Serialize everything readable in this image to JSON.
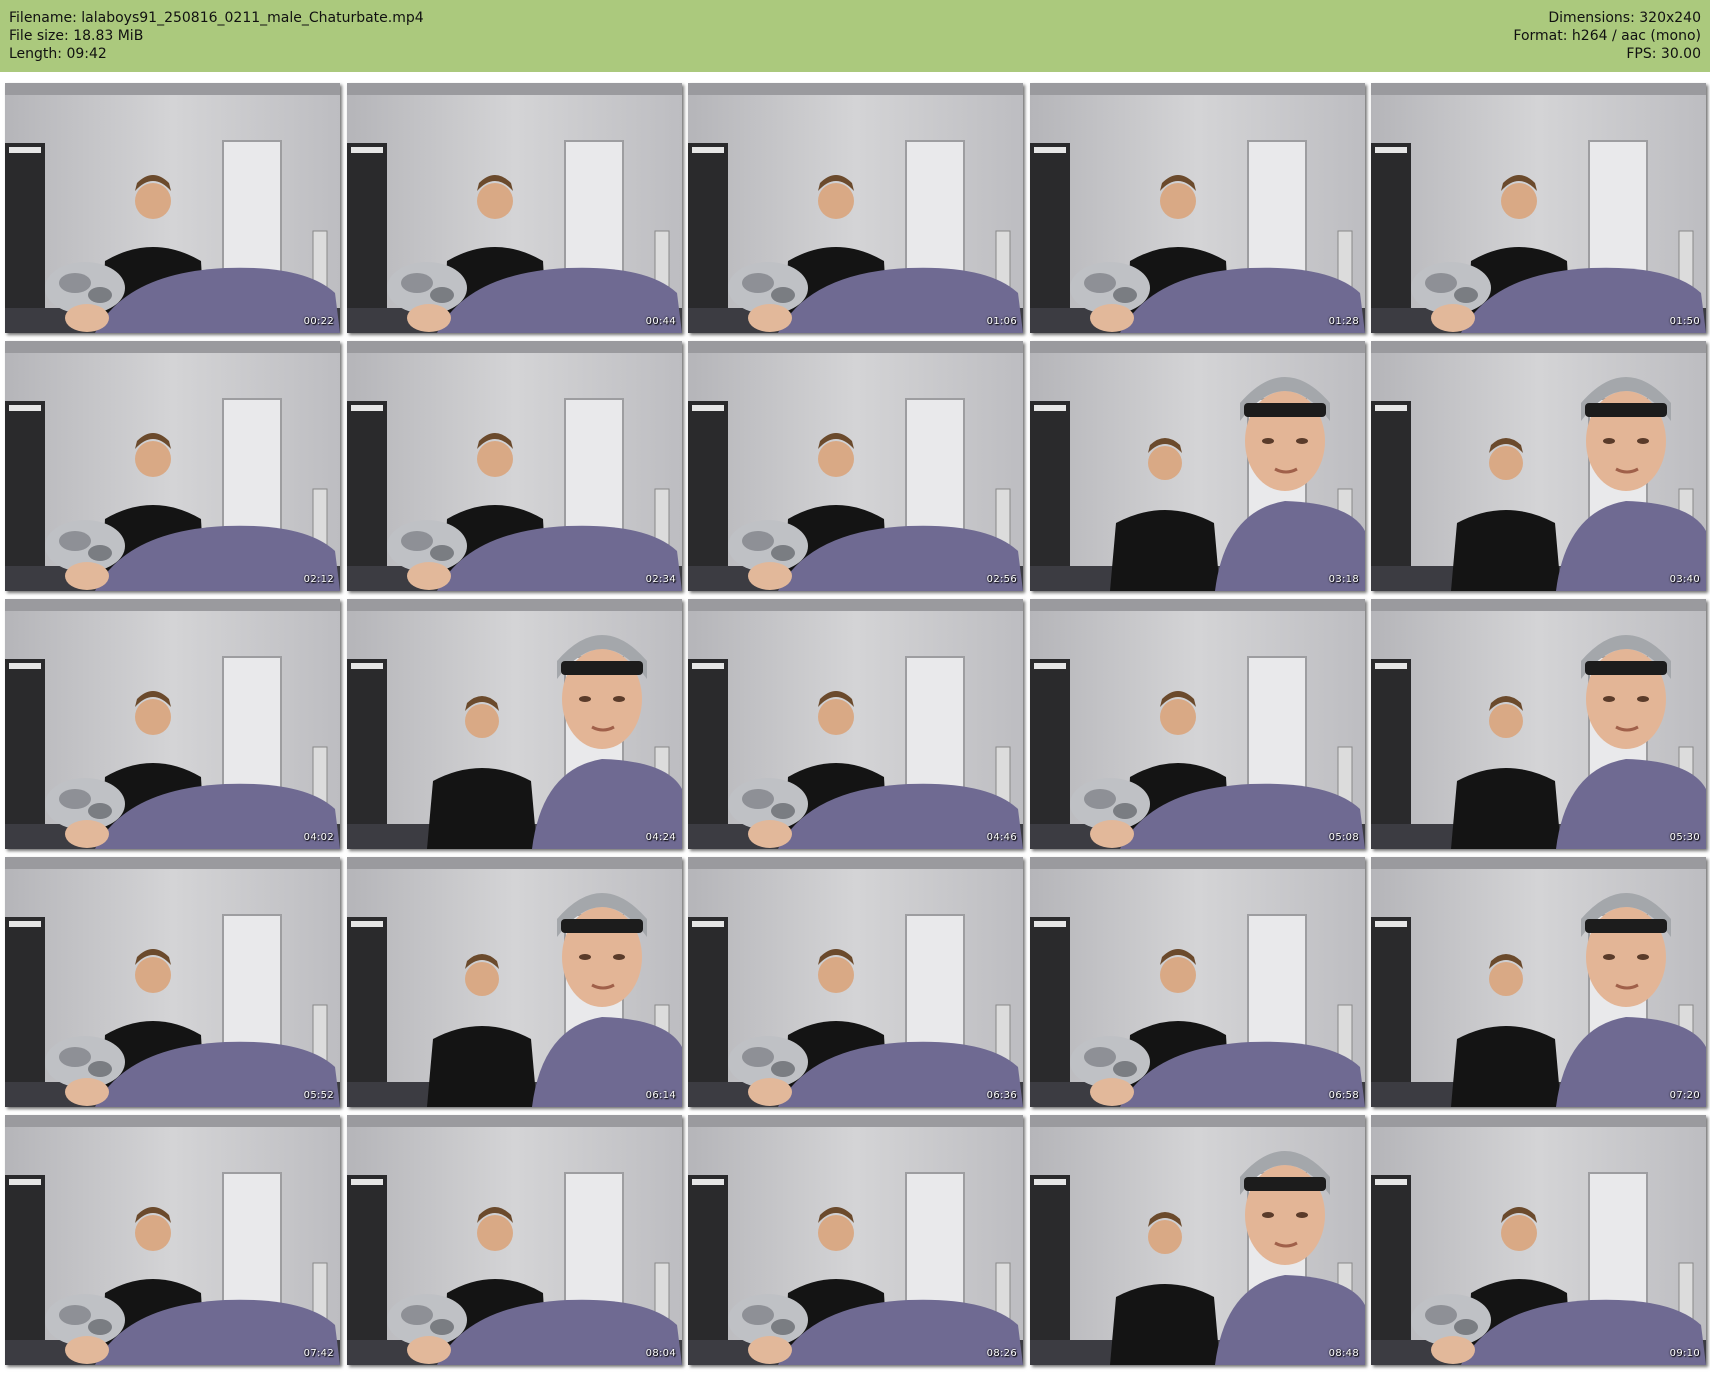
{
  "header": {
    "filename": "Filename: lalaboys91_250816_0211_male_Chaturbate.mp4",
    "filesize": "File size: 18.83 MiB",
    "length": "Length: 09:42",
    "dimensions": "Dimensions: 320x240",
    "format": "Format: h264 / aac (mono)",
    "fps": "FPS: 30.00"
  },
  "colors": {
    "header_bg": "#abc97d",
    "wall": "#c9c9cc",
    "shirt_purple": "#6f6a92",
    "shirt_black": "#141414"
  },
  "thumbnails": [
    {
      "time": "00:22",
      "scene": "lean"
    },
    {
      "time": "00:44",
      "scene": "lean"
    },
    {
      "time": "01:06",
      "scene": "lean"
    },
    {
      "time": "01:28",
      "scene": "lean"
    },
    {
      "time": "01:50",
      "scene": "lean"
    },
    {
      "time": "02:12",
      "scene": "lean"
    },
    {
      "time": "02:34",
      "scene": "lean"
    },
    {
      "time": "02:56",
      "scene": "lean"
    },
    {
      "time": "03:18",
      "scene": "face"
    },
    {
      "time": "03:40",
      "scene": "face"
    },
    {
      "time": "04:02",
      "scene": "lean"
    },
    {
      "time": "04:24",
      "scene": "face"
    },
    {
      "time": "04:46",
      "scene": "lean"
    },
    {
      "time": "05:08",
      "scene": "lean"
    },
    {
      "time": "05:30",
      "scene": "face"
    },
    {
      "time": "05:52",
      "scene": "lean"
    },
    {
      "time": "06:14",
      "scene": "face"
    },
    {
      "time": "06:36",
      "scene": "lean"
    },
    {
      "time": "06:58",
      "scene": "lean"
    },
    {
      "time": "07:20",
      "scene": "face"
    },
    {
      "time": "07:42",
      "scene": "lean"
    },
    {
      "time": "08:04",
      "scene": "lean"
    },
    {
      "time": "08:26",
      "scene": "lean"
    },
    {
      "time": "08:48",
      "scene": "face"
    },
    {
      "time": "09:10",
      "scene": "lean"
    }
  ]
}
